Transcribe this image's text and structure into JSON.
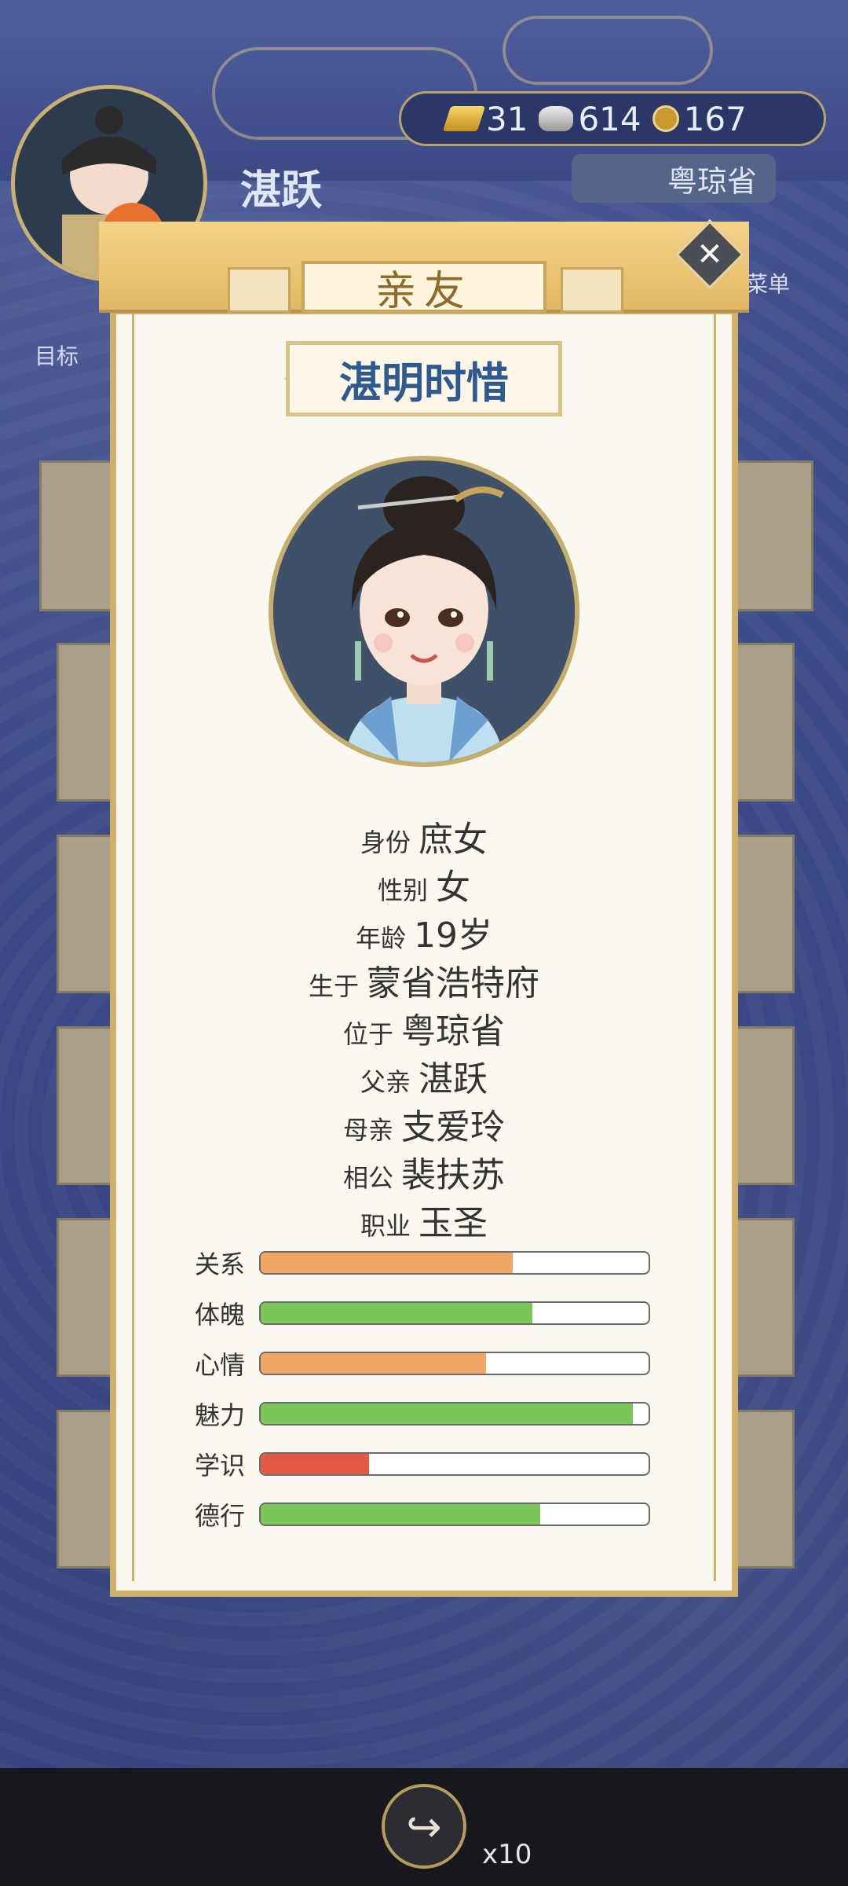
{
  "player": {
    "name": "湛跃",
    "goal_label": "目标",
    "menu_label": "菜单",
    "province": "粤琼省"
  },
  "currency": {
    "gold": "31",
    "silver": "614",
    "coins": "167"
  },
  "modal": {
    "title": "亲友",
    "person_name": "湛明时惜",
    "info": [
      {
        "label": "身份",
        "value": "庶女"
      },
      {
        "label": "性别",
        "value": "女"
      },
      {
        "label": "年龄",
        "value": "19岁"
      },
      {
        "label": "生于",
        "value": "蒙省浩特府"
      },
      {
        "label": "位于",
        "value": "粤琼省"
      },
      {
        "label": "父亲",
        "value": "湛跃"
      },
      {
        "label": "母亲",
        "value": "支爱玲"
      },
      {
        "label": "相公",
        "value": "裴扶苏"
      },
      {
        "label": "职业",
        "value": "玉圣"
      }
    ],
    "stats": [
      {
        "label": "关系",
        "value": 0.65,
        "color": "#f0a767"
      },
      {
        "label": "体魄",
        "value": 0.7,
        "color": "#79c757"
      },
      {
        "label": "心情",
        "value": 0.58,
        "color": "#f0a767"
      },
      {
        "label": "魅力",
        "value": 0.96,
        "color": "#79c757"
      },
      {
        "label": "学识",
        "value": 0.28,
        "color": "#e05a45"
      },
      {
        "label": "德行",
        "value": 0.72,
        "color": "#79c757"
      }
    ]
  },
  "bottom": {
    "share_count": "x10"
  }
}
